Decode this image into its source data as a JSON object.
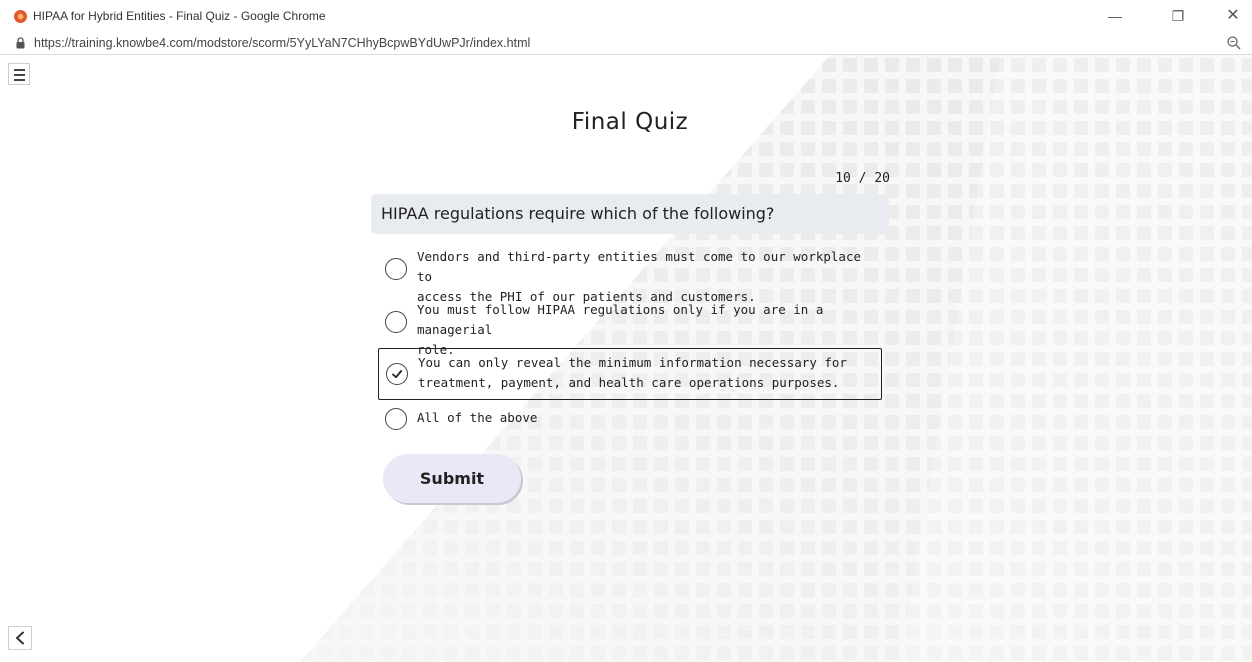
{
  "window": {
    "title": "HIPAA for Hybrid Entities - Final Quiz - Google Chrome",
    "url": "https://training.knowbe4.com/modstore/scorm/5YyLYaN7CHhyBcpwBYdUwPJr/index.html",
    "controls": {
      "minimize": "—",
      "restore": "❐",
      "close": "✕"
    }
  },
  "quiz": {
    "title": "Final Quiz",
    "progress": "10 / 20",
    "question": "HIPAA regulations require which of the following?",
    "options": [
      {
        "line1": "Vendors and third-party entities must come to our workplace to",
        "line2": "access the PHI of our patients and customers.",
        "selected": false
      },
      {
        "line1": "You must follow HIPAA regulations only if you are in a managerial",
        "line2": "role.",
        "selected": false
      },
      {
        "line1": "You can only reveal the minimum information necessary for",
        "line2": "treatment, payment, and health care operations purposes.",
        "selected": true
      },
      {
        "line1": "All of the above",
        "selected": false
      }
    ],
    "submit_label": "Submit"
  },
  "colors": {
    "question_bg": "#e8ebef",
    "submit_bg": "#eae8f6",
    "selected_border": "#222222"
  },
  "icons": {
    "browser": "chrome-icon",
    "lock": "lock-icon",
    "zoom": "zoom-icon",
    "menu": "hamburger-menu-icon",
    "back": "chevron-left-icon",
    "check": "check-icon"
  }
}
